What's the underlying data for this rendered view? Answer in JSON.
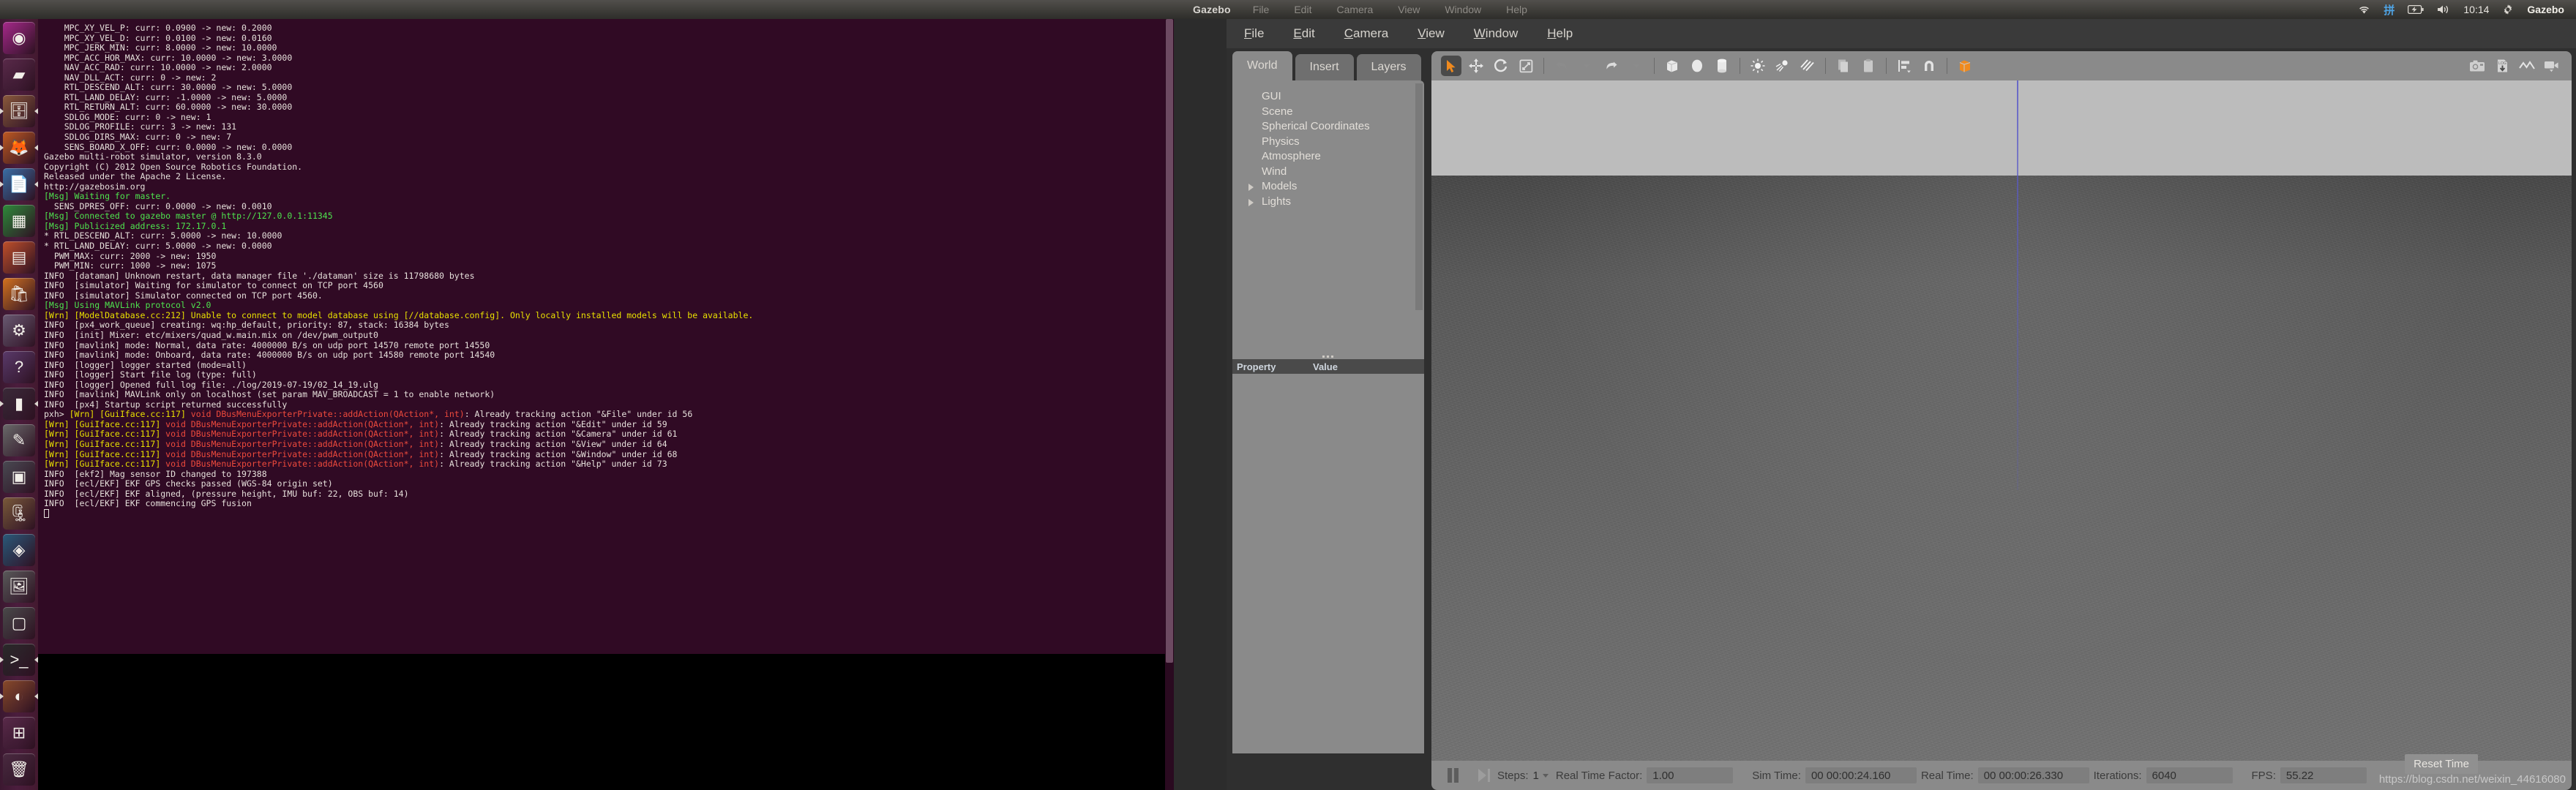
{
  "top_panel": {
    "app_title": "Gazebo",
    "menus": [
      "File",
      "Edit",
      "Camera",
      "View",
      "Window",
      "Help"
    ],
    "indicators": {
      "wifi_icon": "wifi-icon",
      "input_method": "拼",
      "battery_icon": "battery-icon",
      "volume_icon": "volume-icon",
      "clock": "10:14",
      "gear_icon": "gear-icon",
      "app_name": "Gazebo"
    }
  },
  "launcher": {
    "items": [
      {
        "name": "ubuntu-dash",
        "glyph": "◉",
        "bg": "#a6298a",
        "running": false
      },
      {
        "name": "files-ribbon",
        "glyph": "▰",
        "bg": "#5a2a4a",
        "running": false
      },
      {
        "name": "file-manager",
        "glyph": "🗄",
        "bg": "#8b5a3c",
        "running": true
      },
      {
        "name": "firefox",
        "glyph": "🦊",
        "bg": "#c05a22",
        "running": true
      },
      {
        "name": "libreoffice-writer",
        "glyph": "📄",
        "bg": "#3a6ea5",
        "running": true
      },
      {
        "name": "libreoffice-calc",
        "glyph": "▦",
        "bg": "#2e8b3a",
        "running": false
      },
      {
        "name": "libreoffice-impress",
        "glyph": "▤",
        "bg": "#c0502a",
        "running": false
      },
      {
        "name": "ubuntu-software",
        "glyph": "🛍",
        "bg": "#d4731f",
        "running": false
      },
      {
        "name": "settings",
        "glyph": "⚙",
        "bg": "#6a5a72",
        "running": false
      },
      {
        "name": "help",
        "glyph": "?",
        "bg": "#5a3a6a",
        "running": false
      },
      {
        "name": "terminal",
        "glyph": "▮",
        "bg": "#3a2a38",
        "running": true
      },
      {
        "name": "text-editor",
        "glyph": "✎",
        "bg": "#6a6a6a",
        "running": false
      },
      {
        "name": "calculator",
        "glyph": "▣",
        "bg": "#4a4a52",
        "running": false
      },
      {
        "name": "archive-manager",
        "glyph": "🗜",
        "bg": "#7a5a3a",
        "running": false
      },
      {
        "name": "qgroundcontrol",
        "glyph": "◈",
        "bg": "#2a5a7a",
        "running": false
      },
      {
        "name": "image-viewer",
        "glyph": "🖼",
        "bg": "#5a5a5a",
        "running": false
      },
      {
        "name": "screenshot-tool",
        "glyph": "▢",
        "bg": "#4a4a4a",
        "running": false
      },
      {
        "name": "terminal-2",
        "glyph": ">_",
        "bg": "#2a2a2a",
        "running": true
      },
      {
        "name": "gazebo",
        "glyph": "◐",
        "bg": "#8a4a2a",
        "running": true
      },
      {
        "name": "workspace-switcher",
        "glyph": "⊞",
        "bg": "#5a2a4a",
        "running": false
      },
      {
        "name": "trash",
        "glyph": "🗑",
        "bg": "#4a2a40",
        "running": false
      }
    ]
  },
  "terminal": {
    "lines": [
      {
        "color": "white",
        "text": "    MPC_XY_VEL_P: curr: 0.0900 -> new: 0.2000"
      },
      {
        "color": "white",
        "text": "    MPC_XY_VEL_D: curr: 0.0100 -> new: 0.0160"
      },
      {
        "color": "white",
        "text": "    MPC_JERK_MIN: curr: 8.0000 -> new: 10.0000"
      },
      {
        "color": "white",
        "text": "    MPC_ACC_HOR_MAX: curr: 10.0000 -> new: 3.0000"
      },
      {
        "color": "white",
        "text": "    NAV_ACC_RAD: curr: 10.0000 -> new: 2.0000"
      },
      {
        "color": "white",
        "text": "    NAV_DLL_ACT: curr: 0 -> new: 2"
      },
      {
        "color": "white",
        "text": "    RTL_DESCEND_ALT: curr: 30.0000 -> new: 5.0000"
      },
      {
        "color": "white",
        "text": "    RTL_LAND_DELAY: curr: -1.0000 -> new: 5.0000"
      },
      {
        "color": "white",
        "text": "    RTL_RETURN_ALT: curr: 60.0000 -> new: 30.0000"
      },
      {
        "color": "white",
        "text": "    SDLOG_MODE: curr: 0 -> new: 1"
      },
      {
        "color": "white",
        "text": "    SDLOG_PROFILE: curr: 3 -> new: 131"
      },
      {
        "color": "white",
        "text": "    SDLOG_DIRS_MAX: curr: 0 -> new: 7"
      },
      {
        "color": "white",
        "text": "    SENS_BOARD_X_OFF: curr: 0.0000 -> new: 0.0000"
      },
      {
        "color": "white",
        "text": "Gazebo multi-robot simulator, version 8.3.0"
      },
      {
        "color": "white",
        "text": "Copyright (C) 2012 Open Source Robotics Foundation."
      },
      {
        "color": "white",
        "text": "Released under the Apache 2 License."
      },
      {
        "color": "white",
        "text": "http://gazebosim.org"
      },
      {
        "color": "white",
        "text": ""
      },
      {
        "color": "green",
        "text": "[Msg] Waiting for master."
      },
      {
        "color": "white",
        "text": "  SENS_DPRES_OFF: curr: 0.0000 -> new: 0.0010"
      },
      {
        "color": "green",
        "text": "[Msg] Connected to gazebo master @ http://127.0.0.1:11345"
      },
      {
        "color": "green",
        "text": "[Msg] Publicized address: 172.17.0.1"
      },
      {
        "color": "white",
        "text": "* RTL_DESCEND_ALT: curr: 5.0000 -> new: 10.0000"
      },
      {
        "color": "white",
        "text": "* RTL_LAND_DELAY: curr: 5.0000 -> new: 0.0000"
      },
      {
        "color": "white",
        "text": "  PWM_MAX: curr: 2000 -> new: 1950"
      },
      {
        "color": "white",
        "text": "  PWM_MIN: curr: 1000 -> new: 1075"
      },
      {
        "color": "white",
        "text": "INFO  [dataman] Unknown restart, data manager file './dataman' size is 11798680 bytes"
      },
      {
        "color": "white",
        "text": "INFO  [simulator] Waiting for simulator to connect on TCP port 4560"
      },
      {
        "color": "white",
        "text": "INFO  [simulator] Simulator connected on TCP port 4560."
      },
      {
        "color": "green",
        "text": "[Msg] Using MAVLink protocol v2.0"
      },
      {
        "color": "yellow",
        "text": "[Wrn] [ModelDatabase.cc:212] Unable to connect to model database using [//database.config]. Only locally installed models will be available."
      },
      {
        "color": "white",
        "text": "INFO  [px4_work_queue] creating: wq:hp_default, priority: 87, stack: 16384 bytes"
      },
      {
        "color": "white",
        "text": "INFO  [init] Mixer: etc/mixers/quad_w.main.mix on /dev/pwm_output0"
      },
      {
        "color": "white",
        "text": "INFO  [mavlink] mode: Normal, data rate: 4000000 B/s on udp port 14570 remote port 14550"
      },
      {
        "color": "white",
        "text": "INFO  [mavlink] mode: Onboard, data rate: 4000000 B/s on udp port 14580 remote port 14540"
      },
      {
        "color": "white",
        "text": "INFO  [logger] logger started (mode=all)"
      },
      {
        "color": "white",
        "text": "INFO  [logger] Start file log (type: full)"
      },
      {
        "color": "white",
        "text": "INFO  [logger] Opened full log file: ./log/2019-07-19/02_14_19.ulg"
      },
      {
        "color": "white",
        "text": "INFO  [mavlink] MAVLink only on localhost (set param MAV_BROADCAST = 1 to enable network)"
      },
      {
        "color": "white",
        "text": "INFO  [px4] Startup script returned successfully"
      },
      {
        "color": "mixed-wrn",
        "prefix": "pxh> ",
        "tag": "[Wrn] [GuiIface.cc:117]",
        "red": " void DBusMenuExporterPrivate::addAction(QAction*, int)",
        "rest": ": Already tracking action \"&File\" under id 56"
      },
      {
        "color": "mixed-wrn",
        "prefix": "",
        "tag": "[Wrn] [GuiIface.cc:117]",
        "red": " void DBusMenuExporterPrivate::addAction(QAction*, int)",
        "rest": ": Already tracking action \"&Edit\" under id 59"
      },
      {
        "color": "mixed-wrn",
        "prefix": "",
        "tag": "[Wrn] [GuiIface.cc:117]",
        "red": " void DBusMenuExporterPrivate::addAction(QAction*, int)",
        "rest": ": Already tracking action \"&Camera\" under id 61"
      },
      {
        "color": "mixed-wrn",
        "prefix": "",
        "tag": "[Wrn] [GuiIface.cc:117]",
        "red": " void DBusMenuExporterPrivate::addAction(QAction*, int)",
        "rest": ": Already tracking action \"&View\" under id 64"
      },
      {
        "color": "mixed-wrn",
        "prefix": "",
        "tag": "[Wrn] [GuiIface.cc:117]",
        "red": " void DBusMenuExporterPrivate::addAction(QAction*, int)",
        "rest": ": Already tracking action \"&Window\" under id 68"
      },
      {
        "color": "mixed-wrn",
        "prefix": "",
        "tag": "[Wrn] [GuiIface.cc:117]",
        "red": " void DBusMenuExporterPrivate::addAction(QAction*, int)",
        "rest": ": Already tracking action \"&Help\" under id 73"
      },
      {
        "color": "white",
        "text": "INFO  [ekf2] Mag sensor ID changed to 197388"
      },
      {
        "color": "white",
        "text": "INFO  [ecl/EKF] EKF GPS checks passed (WGS-84 origin set)"
      },
      {
        "color": "white",
        "text": "INFO  [ecl/EKF] EKF aligned, (pressure height, IMU buf: 22, OBS buf: 14)"
      },
      {
        "color": "white",
        "text": "INFO  [ecl/EKF] EKF commencing GPS fusion"
      }
    ]
  },
  "gazebo": {
    "menus": [
      {
        "label": "File",
        "mnemonic": "F"
      },
      {
        "label": "Edit",
        "mnemonic": "E"
      },
      {
        "label": "Camera",
        "mnemonic": "C"
      },
      {
        "label": "View",
        "mnemonic": "V"
      },
      {
        "label": "Window",
        "mnemonic": "W"
      },
      {
        "label": "Help",
        "mnemonic": "H"
      }
    ],
    "tabs": [
      {
        "label": "World",
        "active": true
      },
      {
        "label": "Insert",
        "active": false
      },
      {
        "label": "Layers",
        "active": false
      }
    ],
    "world_tree": [
      {
        "label": "GUI",
        "expandable": false
      },
      {
        "label": "Scene",
        "expandable": false
      },
      {
        "label": "Spherical Coordinates",
        "expandable": false
      },
      {
        "label": "Physics",
        "expandable": false
      },
      {
        "label": "Atmosphere",
        "expandable": false
      },
      {
        "label": "Wind",
        "expandable": false
      },
      {
        "label": "Models",
        "expandable": true
      },
      {
        "label": "Lights",
        "expandable": true
      }
    ],
    "property_table": {
      "columns": [
        "Property",
        "Value"
      ],
      "rows": []
    },
    "toolbar": [
      {
        "name": "select-mode-icon",
        "selected": true
      },
      {
        "name": "translate-mode-icon",
        "selected": false
      },
      {
        "name": "rotate-mode-icon",
        "selected": false
      },
      {
        "name": "scale-mode-icon",
        "selected": false
      },
      {
        "name": "undo-icon",
        "selected": false
      },
      {
        "name": "undo-dropdown-icon",
        "selected": false
      },
      {
        "name": "redo-icon",
        "selected": false
      },
      {
        "name": "redo-dropdown-icon",
        "selected": false
      },
      {
        "name": "insert-box-icon",
        "selected": false
      },
      {
        "name": "insert-sphere-icon",
        "selected": false
      },
      {
        "name": "insert-cylinder-icon",
        "selected": false
      },
      {
        "name": "point-light-icon",
        "selected": false
      },
      {
        "name": "spot-light-icon",
        "selected": false
      },
      {
        "name": "directional-light-icon",
        "selected": false
      },
      {
        "name": "copy-icon",
        "selected": false
      },
      {
        "name": "paste-icon",
        "selected": false
      },
      {
        "name": "align-icon",
        "selected": false
      },
      {
        "name": "snap-icon",
        "selected": false
      },
      {
        "name": "apply-material-icon",
        "selected": false
      }
    ],
    "toolbar_right": [
      {
        "name": "screenshot-icon"
      },
      {
        "name": "log-download-icon"
      },
      {
        "name": "plot-icon"
      },
      {
        "name": "video-record-icon"
      }
    ],
    "status_bar": {
      "pause_icon": "pause-icon",
      "step_icon": "step-forward-icon",
      "steps_label": "Steps:",
      "steps_value": "1",
      "rtf_label": "Real Time Factor:",
      "rtf_value": "1.00",
      "sim_time_label": "Sim Time:",
      "sim_time_value": "00 00:00:24.160",
      "real_time_label": "Real Time:",
      "real_time_value": "00 00:00:26.330",
      "iterations_label": "Iterations:",
      "iterations_value": "6040",
      "fps_label": "FPS:",
      "fps_value": "55.22",
      "reset_button": "Reset Time"
    },
    "watermark": "https://blog.csdn.net/weixin_44616080"
  }
}
